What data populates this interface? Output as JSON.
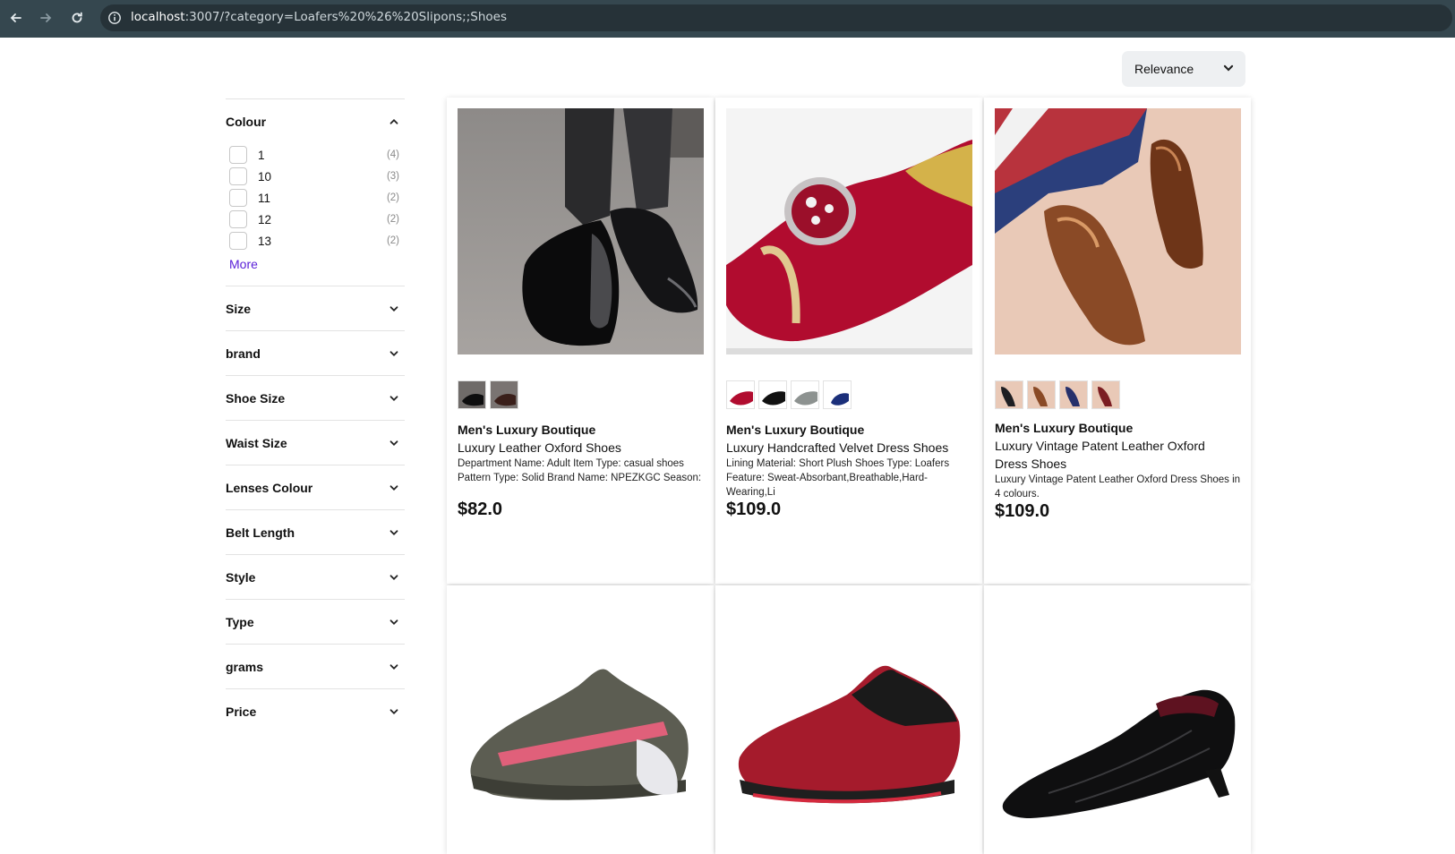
{
  "browser": {
    "url_host": "localhost",
    "url_rest": ":3007/?category=Loafers%20%26%20Slipons;;Shoes"
  },
  "sort": {
    "selected": "Relevance"
  },
  "sidebar": {
    "colour": {
      "title": "Colour",
      "options": [
        {
          "label": "1",
          "count": "(4)"
        },
        {
          "label": "10",
          "count": "(3)"
        },
        {
          "label": "11",
          "count": "(2)"
        },
        {
          "label": "12",
          "count": "(2)"
        },
        {
          "label": "13",
          "count": "(2)"
        }
      ],
      "more_label": "More"
    },
    "filters": [
      "Size",
      "brand",
      "Shoe Size",
      "Waist Size",
      "Lenses Colour",
      "Belt Length",
      "Style",
      "Type",
      "grams",
      "Price"
    ]
  },
  "products": [
    {
      "brand": "Men's Luxury Boutique",
      "title": "Luxury Leather Oxford Shoes",
      "description": "Department Name: Adult Item Type: casual shoes Pattern Type: Solid Brand Name: NPEZKGC Season:",
      "price": "$82.0",
      "swatches": 2
    },
    {
      "brand": "Men's Luxury Boutique",
      "title": "Luxury Handcrafted Velvet Dress Shoes",
      "description": "Lining Material: Short Plush Shoes Type: Loafers Feature: Sweat-Absorbant,Breathable,Hard-Wearing,Li",
      "price": "$109.0",
      "swatches": 4
    },
    {
      "brand": "Men's Luxury Boutique",
      "title": "Luxury Vintage Patent Leather Oxford Dress Shoes",
      "description": "Luxury Vintage Patent Leather Oxford Dress Shoes in 4 colours.",
      "price": "$109.0",
      "swatches": 4
    }
  ],
  "colors": {
    "accent_link": "#5b21d8",
    "browser_bar": "#35474f"
  }
}
